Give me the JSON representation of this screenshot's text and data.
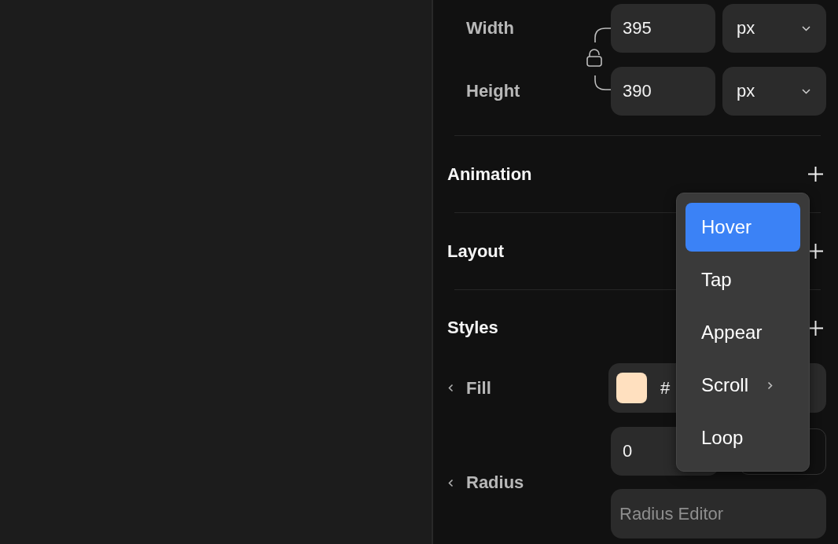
{
  "dimensions": {
    "locked": false,
    "rows": [
      {
        "label": "Width",
        "value": "395",
        "unit": "px"
      },
      {
        "label": "Height",
        "value": "390",
        "unit": "px"
      }
    ]
  },
  "sections": [
    {
      "title": "Animation"
    },
    {
      "title": "Layout"
    },
    {
      "title": "Styles"
    }
  ],
  "styles": {
    "fill": {
      "label": "Fill",
      "color": "#ffe0bf",
      "value": "#"
    },
    "radius": {
      "label": "Radius",
      "value": "0",
      "editor_placeholder": "Radius Editor"
    }
  },
  "menu": {
    "items": [
      {
        "label": "Hover",
        "selected": true,
        "submenu": false
      },
      {
        "label": "Tap",
        "selected": false,
        "submenu": false
      },
      {
        "label": "Appear",
        "selected": false,
        "submenu": false
      },
      {
        "label": "Scroll",
        "selected": false,
        "submenu": true
      },
      {
        "label": "Loop",
        "selected": false,
        "submenu": false
      }
    ]
  }
}
